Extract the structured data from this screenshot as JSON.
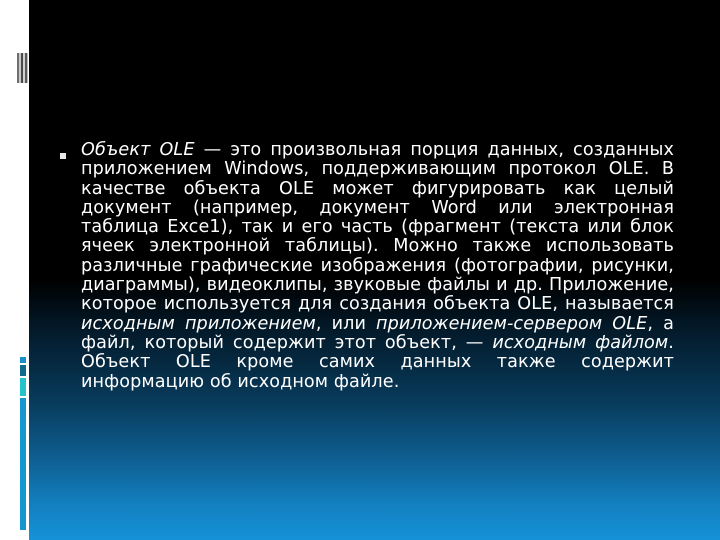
{
  "slide": {
    "bullet_icon": "square-bullet",
    "paragraph": {
      "segments": [
        {
          "text": "Объект OLE",
          "italic": true
        },
        {
          "text": " — это произвольная порция данных, созданных приложением Windows, поддерживающим протокол OLE. В качестве объекта OLE может фигурировать как целый документ (например, документ Word или электронная таблица Exce1), так и его часть (фрагмент (текста или блок ячеек электронной таблицы). Можно также использовать различные графические изображения (фотографии, рисунки, диаграммы), видеоклипы, звуковые файлы и др. Приложение, которое используется для создания объекта OLE, называется ",
          "italic": false
        },
        {
          "text": "исходным приложением",
          "italic": true
        },
        {
          "text": ", или ",
          "italic": false
        },
        {
          "text": "приложением-сервером OLE",
          "italic": true
        },
        {
          "text": ", а файл, который содержит этот объект, — ",
          "italic": false
        },
        {
          "text": "исходным файлом",
          "italic": true
        },
        {
          "text": ". Объект OLE кроме самих данных также содержит информацию об исходном файле.",
          "italic": false
        }
      ]
    }
  },
  "theme": {
    "text_color": "#ffffff",
    "background_top": "#000000",
    "background_bottom": "#1592d8",
    "accent_bars": [
      "#1a8fc8",
      "#106a8a",
      "#22c3c9",
      "#1496cf"
    ]
  }
}
